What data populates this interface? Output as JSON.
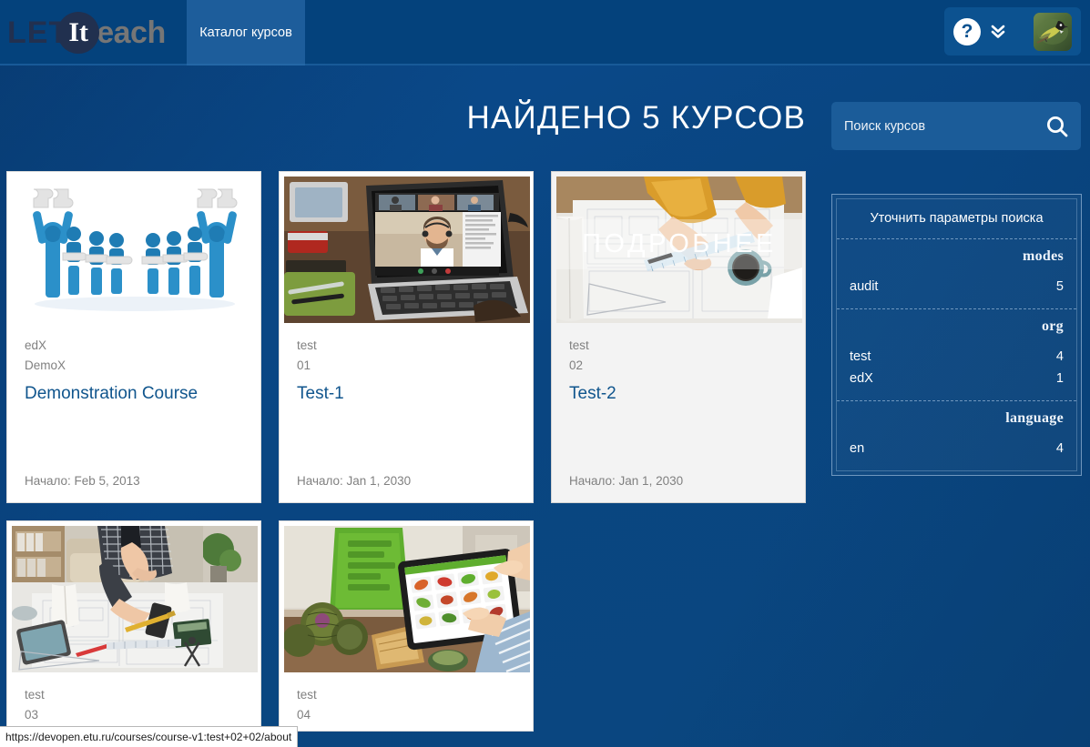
{
  "brand": {
    "logo_part1": "LET",
    "logo_part2": "It",
    "logo_part3": "each"
  },
  "navbar": {
    "tab_label": "Каталог курсов",
    "help_icon_label": "?",
    "icons": {
      "help": "help-question-icon",
      "chevron": "chevron-double-down-icon",
      "avatar": "user-avatar-bird"
    }
  },
  "header": {
    "results_title": "НАЙДЕНО 5 КУРСОВ"
  },
  "search": {
    "placeholder": "Поиск курсов",
    "value": "",
    "icon": "search-icon"
  },
  "facets": {
    "title": "Уточнить параметры поиска",
    "groups": [
      {
        "name": "modes",
        "items": [
          {
            "label": "audit",
            "count": "5"
          }
        ]
      },
      {
        "name": "org",
        "items": [
          {
            "label": "test",
            "count": "4"
          },
          {
            "label": "edX",
            "count": "1"
          }
        ]
      },
      {
        "name": "language",
        "items": [
          {
            "label": "en",
            "count": "4"
          }
        ]
      }
    ]
  },
  "courses": [
    {
      "org": "edX",
      "number": "DemoX",
      "title": "Demonstration Course",
      "start": "Начало: Feb 5, 2013",
      "image": "puzzle-people-illustration",
      "hovered": false,
      "overlay": ""
    },
    {
      "org": "test",
      "number": "01",
      "title": "Test-1",
      "start": "Начало: Jan 1, 2030",
      "image": "laptop-video-conference-photo",
      "hovered": false,
      "overlay": ""
    },
    {
      "org": "test",
      "number": "02",
      "title": "Test-2",
      "start": "Начало: Jan 1, 2030",
      "image": "blueprint-drafting-photo",
      "hovered": true,
      "overlay": "ПОДРОБНЕЕ"
    },
    {
      "org": "test",
      "number": "03",
      "title": "",
      "start": "",
      "image": "architect-desk-photo",
      "hovered": false,
      "overlay": ""
    },
    {
      "org": "test",
      "number": "04",
      "title": "",
      "start": "",
      "image": "tablet-groceries-photo",
      "hovered": false,
      "overlay": ""
    }
  ],
  "status_bar": {
    "url": "https://devopen.etu.ru/courses/course-v1:test+02+02/about"
  },
  "colors": {
    "page_blue": "#0a4581",
    "navbar_blue": "#04427c",
    "tab_blue": "#1d5d9b",
    "search_blue": "#1b5c99",
    "card_title_blue": "#10558d",
    "muted_gray": "#808080"
  }
}
